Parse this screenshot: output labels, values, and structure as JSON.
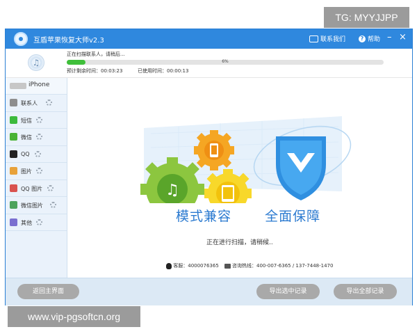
{
  "overlay": {
    "tg_label": "TG: MYYJJPP",
    "watermark": "www.vip-pgsoftcn.org"
  },
  "titlebar": {
    "title": "互盾苹果恢复大师v2.3",
    "contact": "联系我们",
    "help": "帮助",
    "minimize": "–",
    "close": "×",
    "color": "#2f88de"
  },
  "progress": {
    "status": "正在扫描联系人，请稍后...",
    "percent_label": "6%",
    "percent": 6,
    "time_left": "预计剩余时间：00:03:23",
    "time_used": "已使用时间：00:00:13",
    "fill_color": "#3fbf3a"
  },
  "sidebar": {
    "device": "iPhone",
    "categories": [
      {
        "label": "联系人",
        "icon": "contacts-icon",
        "color": "#8e8e8e"
      },
      {
        "label": "短信",
        "icon": "sms-icon",
        "color": "#3cba3c"
      },
      {
        "label": "微信",
        "icon": "wechat-icon",
        "color": "#49b334"
      },
      {
        "label": "QQ",
        "icon": "qq-icon",
        "color": "#222222"
      },
      {
        "label": "图片",
        "icon": "photos-icon",
        "color": "#e8a23a"
      },
      {
        "label": "QQ 图片",
        "icon": "qq-photos-icon",
        "color": "#d9534f"
      },
      {
        "label": "微信图片",
        "icon": "wechat-photos-icon",
        "color": "#4ca35c"
      },
      {
        "label": "其他",
        "icon": "other-icon",
        "color": "#7a6fd0"
      }
    ]
  },
  "main": {
    "slogan_left": "模式兼容",
    "slogan_right": "全面保障",
    "scanning": "正在进行扫描，请稍候..",
    "support_qq": "客服：4000076365",
    "hotline": "咨询热线：400-007-6365 / 137-7448-1470"
  },
  "buttons": {
    "back": "返回主界面",
    "export_selected": "导出选中记录",
    "export_all": "导出全部记录"
  }
}
